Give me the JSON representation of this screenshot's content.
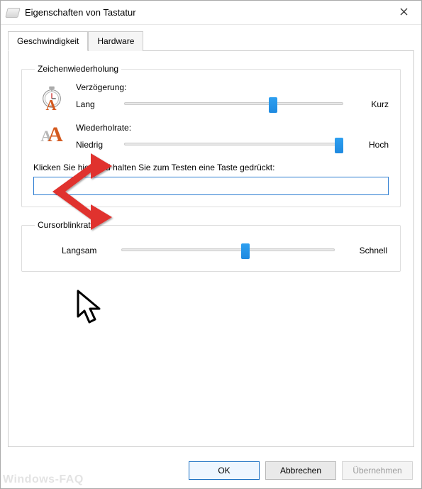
{
  "window": {
    "title": "Eigenschaften von Tastatur"
  },
  "tabs": {
    "speed": "Geschwindigkeit",
    "hardware": "Hardware"
  },
  "repeat_group": {
    "legend": "Zeichenwiederholung",
    "delay": {
      "heading": "Verzögerung:",
      "left": "Lang",
      "right": "Kurz",
      "value_percent": 68
    },
    "rate": {
      "heading": "Wiederholrate:",
      "left": "Niedrig",
      "right": "Hoch",
      "value_percent": 98
    },
    "test": {
      "label": "Klicken Sie hier, und halten Sie zum Testen eine Taste gedrückt:",
      "value": ""
    }
  },
  "blink_group": {
    "legend": "Cursorblinkrate",
    "left": "Langsam",
    "right": "Schnell",
    "value_percent": 58
  },
  "buttons": {
    "ok": "OK",
    "cancel": "Abbrechen",
    "apply": "Übernehmen"
  },
  "watermark": "Windows-FAQ"
}
